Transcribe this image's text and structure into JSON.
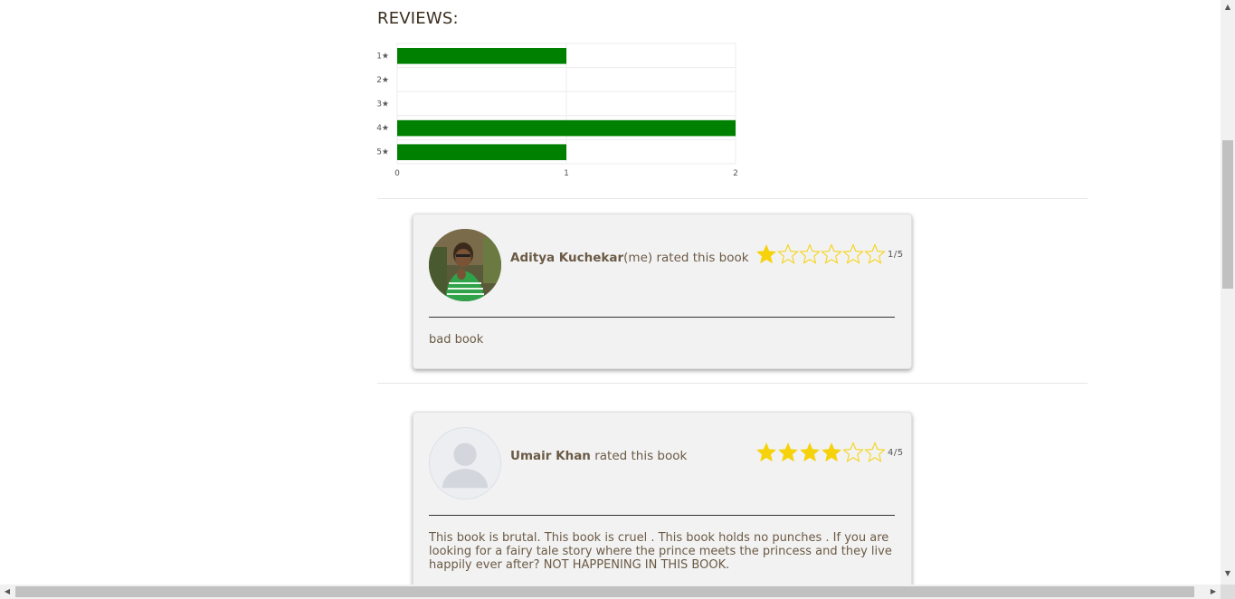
{
  "section": {
    "title": "REVIEWS:"
  },
  "chart_data": {
    "type": "bar",
    "orientation": "horizontal",
    "categories": [
      "1★",
      "2★",
      "3★",
      "4★",
      "5★"
    ],
    "values": [
      1,
      0,
      0,
      2,
      1
    ],
    "xlim": [
      0,
      2
    ],
    "xticks": [
      "0",
      "1",
      "2"
    ],
    "title": "",
    "xlabel": "",
    "ylabel": "",
    "grid": true,
    "color": "#008000"
  },
  "reviews": [
    {
      "name": "Aditya Kuchekar",
      "name_suffix": "(me)",
      "action": " rated this book",
      "rating": 1,
      "score_label": "1/5",
      "text": "bad book",
      "avatar": "user-photo"
    },
    {
      "name": "Umair Khan",
      "name_suffix": "",
      "action": " rated this book",
      "rating": 4,
      "score_label": "4/5",
      "text": "This book is brutal. This book is cruel . This book holds no punches . If you are looking for a fairy tale story where the prince meets the princess and they live happily ever after? NOT HAPPENING IN THIS BOOK.",
      "avatar": "default-avatar-placeholder"
    }
  ],
  "colors": {
    "star": "#f5d20a",
    "bar": "#008000"
  },
  "scrollbars": {
    "vertical": "scrollbar-vertical",
    "horizontal": "scrollbar-horizontal"
  }
}
